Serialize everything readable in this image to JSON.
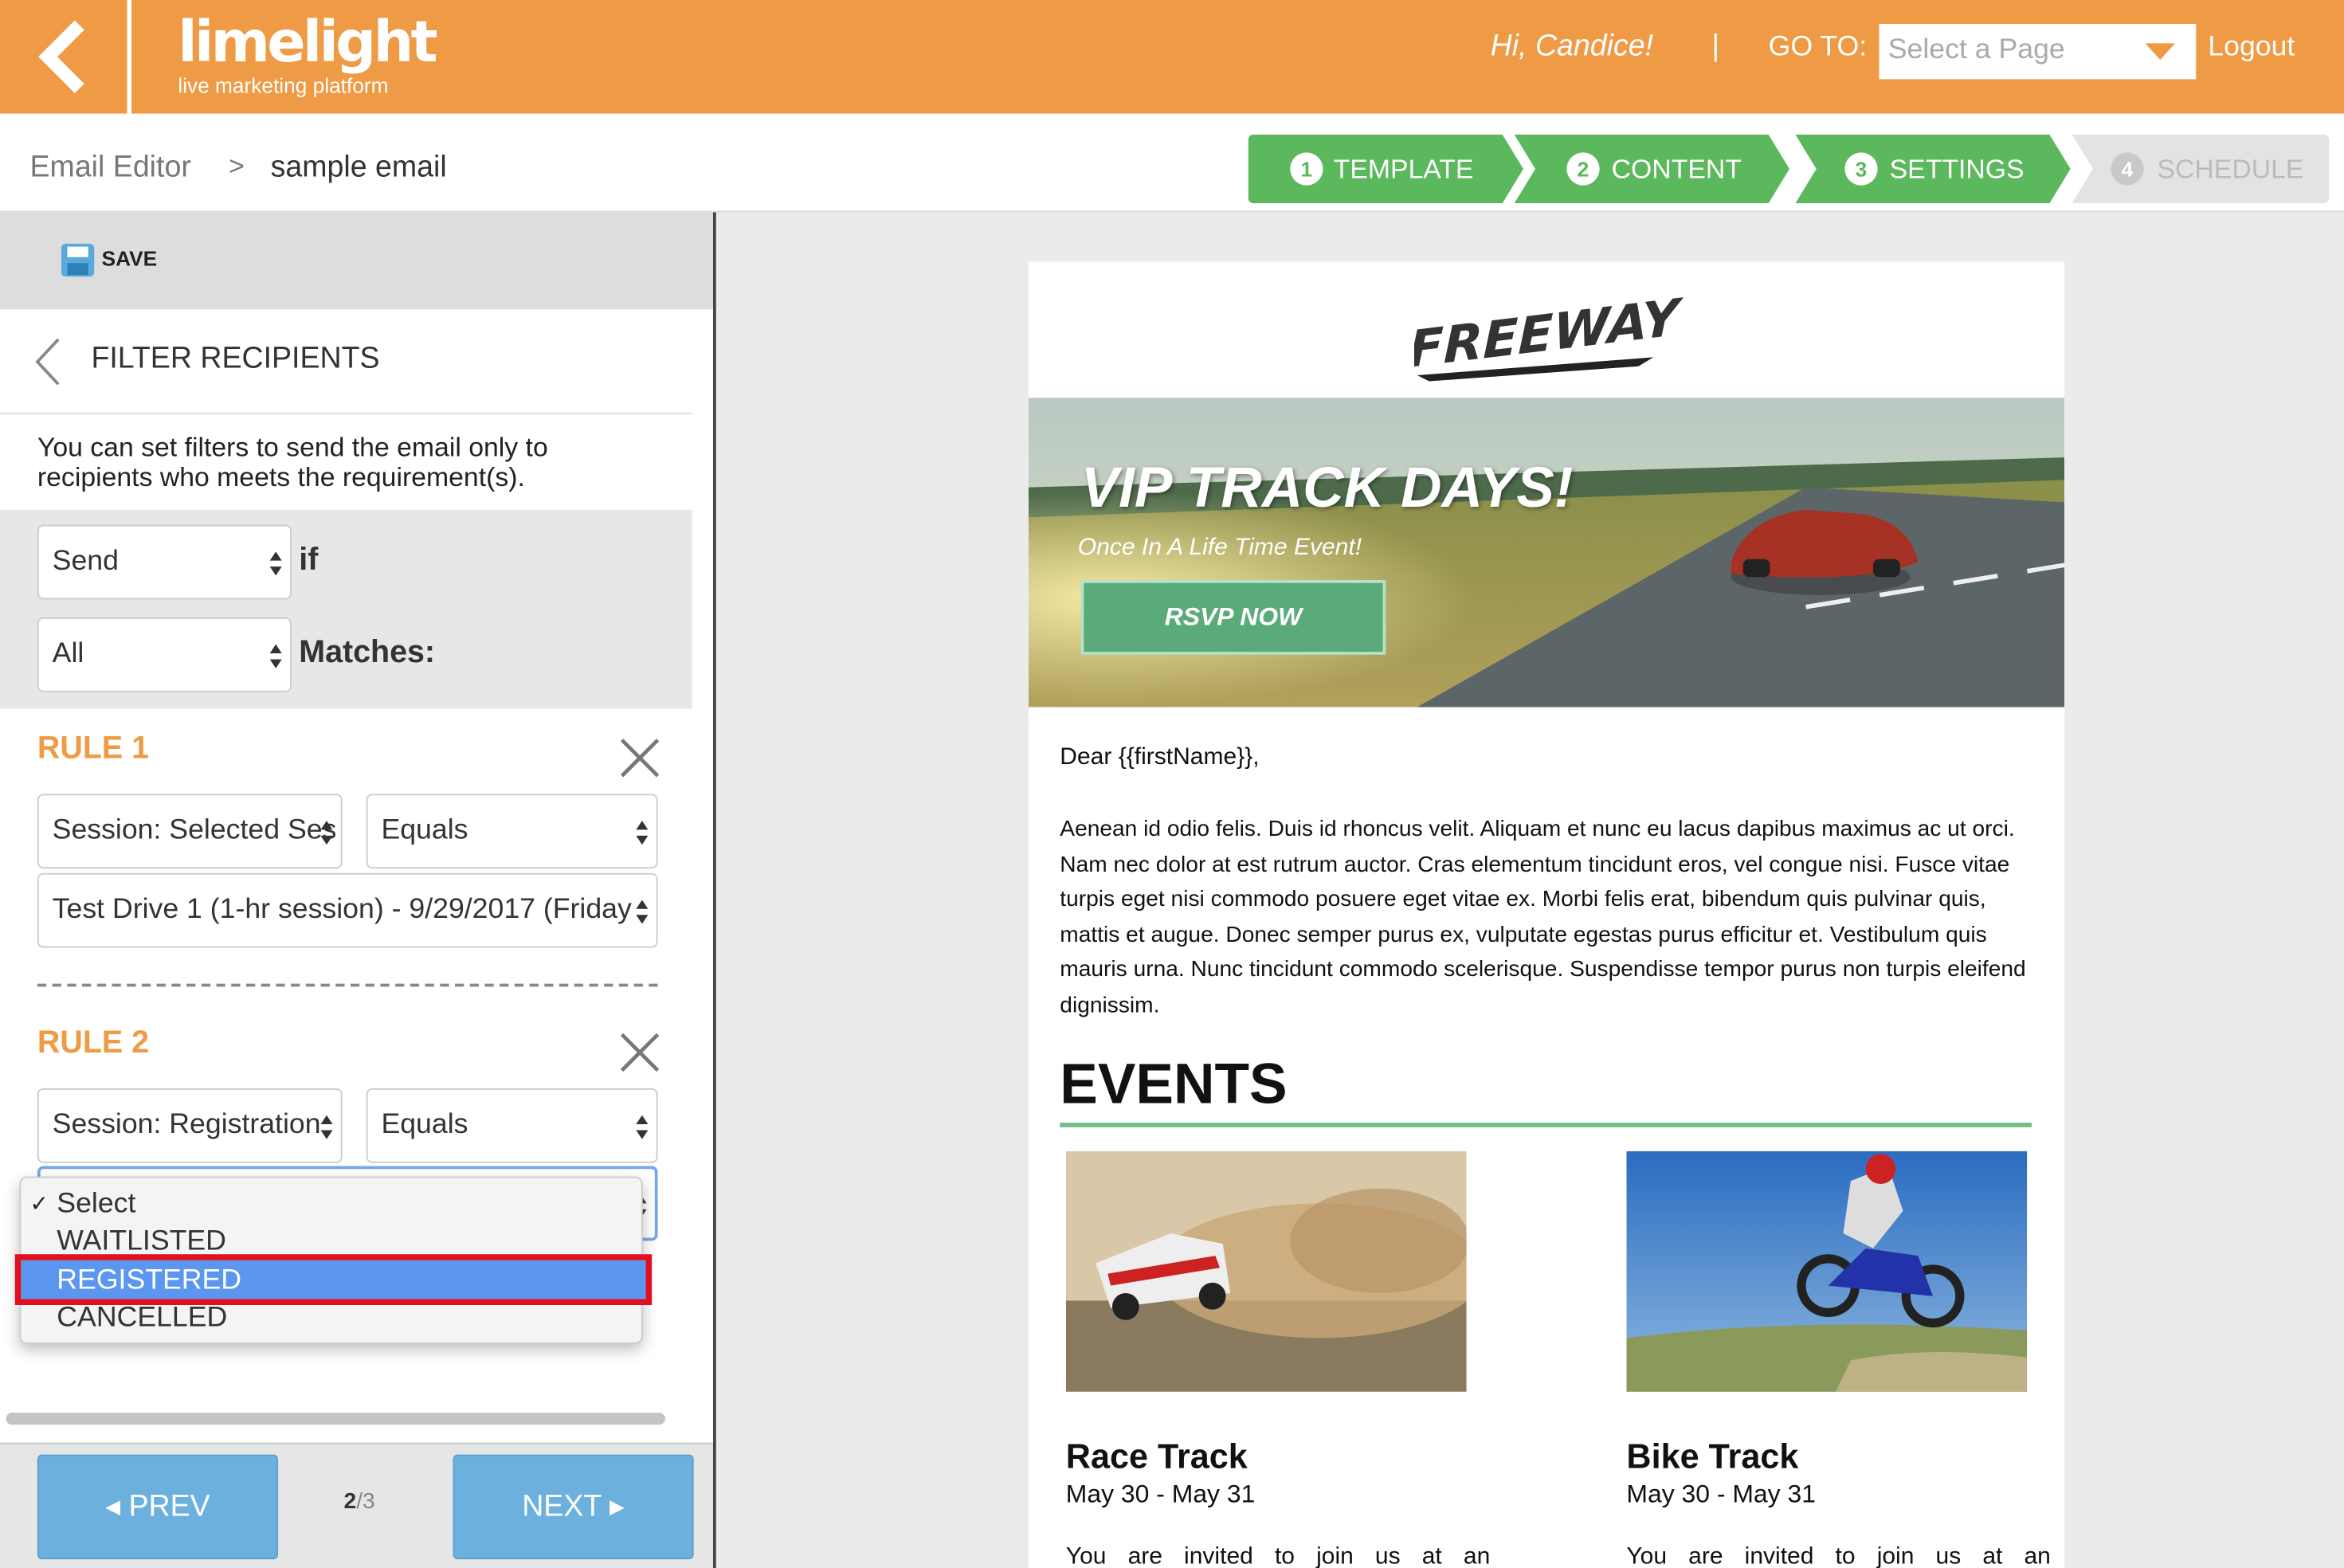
{
  "header": {
    "logo_main": "limelight",
    "logo_sub": "live marketing platform",
    "greeting": "Hi,  Candice!",
    "separator": "|",
    "goto_label": "GO TO:",
    "page_select_placeholder": "Select a Page",
    "logout": "Logout"
  },
  "breadcrumb": {
    "root": "Email Editor",
    "sep": ">",
    "current": "sample email"
  },
  "steps": [
    {
      "num": "1",
      "label": "TEMPLATE",
      "state": "done"
    },
    {
      "num": "2",
      "label": "CONTENT",
      "state": "done"
    },
    {
      "num": "3",
      "label": "SETTINGS",
      "state": "done"
    },
    {
      "num": "4",
      "label": "SCHEDULE",
      "state": "disabled"
    }
  ],
  "panel": {
    "save_label": "SAVE",
    "title": "FILTER RECIPIENTS",
    "description": "You can set filters to send the email only to recipients who meets the requirement(s).",
    "send_select": "Send",
    "if_label": "if",
    "match_select": "All",
    "matches_label": "Matches:",
    "rules": [
      {
        "title": "RULE 1",
        "field": "Session: Selected Ses",
        "operator": "Equals",
        "value": "Test Drive 1 (1-hr session) - 9/29/2017 (Friday"
      },
      {
        "title": "RULE 2",
        "field": "Session: Registration",
        "operator": "Equals",
        "value": "Select"
      }
    ],
    "dropdown_options": [
      {
        "label": "Select",
        "checked": true
      },
      {
        "label": "WAITLISTED",
        "checked": false
      },
      {
        "label": "REGISTERED",
        "checked": false,
        "highlighted": true
      },
      {
        "label": "CANCELLED",
        "checked": false
      }
    ],
    "check_mark": "✓",
    "prev_label": "◂ PREV",
    "next_label": "NEXT ▸",
    "page_current": "2",
    "page_sep": "/",
    "page_total": "3"
  },
  "email": {
    "brand": "FREEWAY",
    "hero_title": "VIP TRACK DAYS!",
    "hero_subtitle": "Once In A Life Time Event!",
    "rsvp_label": "RSVP NOW",
    "salutation": "Dear {{firstName}},",
    "body": "Aenean id odio felis. Duis id rhoncus velit. Aliquam et nunc eu lacus dapibus maximus ac ut orci. Nam nec dolor at est rutrum auctor. Cras elementum tincidunt eros, vel congue nisi. Fusce vitae turpis eget nisi commodo posuere eget vitae ex. Morbi felis erat, bibendum quis pulvinar quis, mattis et augue. Donec semper purus ex, vulputate egestas purus efficitur et. Vestibulum quis mauris urna. Nunc tincidunt commodo scelerisque. Suspendisse tempor purus non turpis eleifend dignissim.",
    "events_heading": "EVENTS",
    "events": [
      {
        "name": "Race Track",
        "date": "May 30 - May 31",
        "desc": "You are invited to join us at an"
      },
      {
        "name": "Bike Track",
        "date": "May 30 - May 31",
        "desc": "You are invited to join us at an"
      }
    ]
  },
  "colors": {
    "brand_orange": "#ef9a45",
    "step_green": "#5cb85c",
    "step_disabled": "#e3e3e3",
    "rule_orange": "#ef9a45",
    "nav_blue": "#6cb0dd",
    "highlight_blue": "#5b96f0",
    "highlight_border_red": "#e01020",
    "events_rule_green": "#6bbf83"
  }
}
